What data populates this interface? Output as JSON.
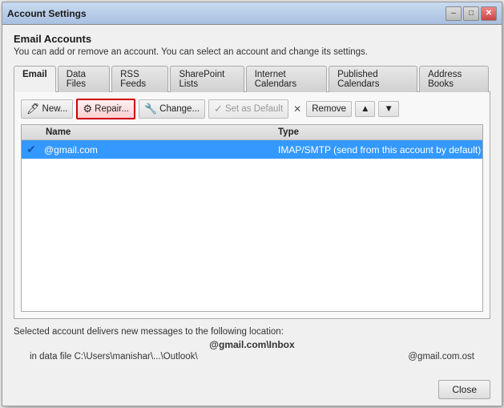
{
  "window": {
    "title": "Account Settings",
    "min_btn": "–",
    "max_btn": "□",
    "close_btn": "✕"
  },
  "header": {
    "title": "Email Accounts",
    "description": "You can add or remove an account. You can select an account and change its settings."
  },
  "tabs": [
    {
      "id": "email",
      "label": "Email",
      "active": true
    },
    {
      "id": "data-files",
      "label": "Data Files",
      "active": false
    },
    {
      "id": "rss-feeds",
      "label": "RSS Feeds",
      "active": false
    },
    {
      "id": "sharepoint",
      "label": "SharePoint Lists",
      "active": false
    },
    {
      "id": "internet-cal",
      "label": "Internet Calendars",
      "active": false
    },
    {
      "id": "published-cal",
      "label": "Published Calendars",
      "active": false
    },
    {
      "id": "address-books",
      "label": "Address Books",
      "active": false
    }
  ],
  "toolbar": {
    "new_label": "New...",
    "repair_label": "Repair...",
    "change_label": "Change...",
    "set_default_label": "Set as Default",
    "remove_label": "Remove",
    "move_up_label": "▲",
    "move_down_label": "▼"
  },
  "account_list": {
    "col_name": "Name",
    "col_type": "Type",
    "accounts": [
      {
        "name": "@gmail.com",
        "type": "IMAP/SMTP (send from this account by default)",
        "default": true
      }
    ]
  },
  "footer": {
    "label": "Selected account delivers new messages to the following location:",
    "location_name": "@gmail.com\\Inbox",
    "data_file_prefix": "in data file C:\\Users\\manishar\\...\\Outlook\\",
    "data_file_name": "@gmail.com.ost"
  },
  "bottom": {
    "close_label": "Close"
  }
}
